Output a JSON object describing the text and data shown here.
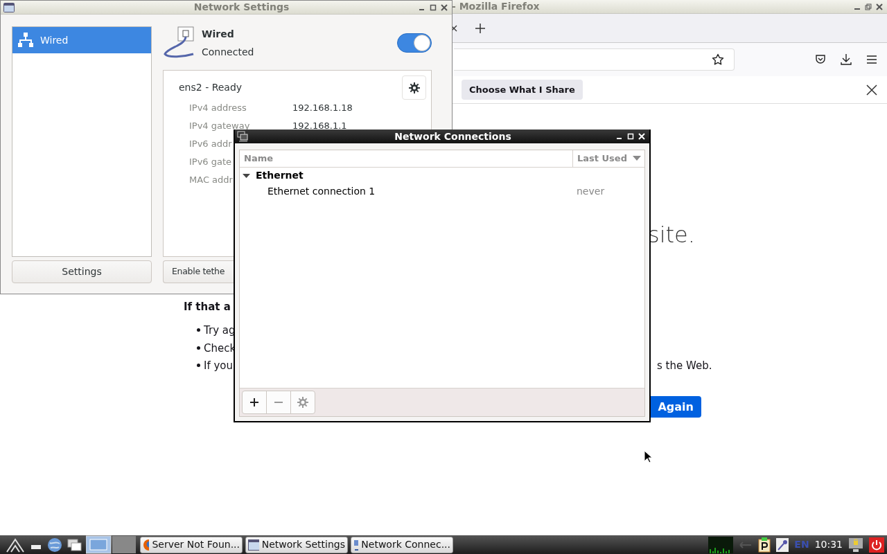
{
  "firefox": {
    "title": "- Mozilla Firefox",
    "notification": {
      "button": "Choose What I Share"
    },
    "page": {
      "heading": "site.",
      "subheading": "If that a",
      "bullets": [
        {
          "start": "Try ag"
        },
        {
          "start": "Check"
        },
        {
          "start": "If you",
          "end": "s the Web."
        }
      ],
      "button": "Again"
    }
  },
  "network_settings": {
    "title": "Network Settings",
    "sidebar": [
      {
        "label": "Wired",
        "selected": true
      }
    ],
    "settings_button": "Settings",
    "device": {
      "name": "Wired",
      "status": "Connected",
      "on": true
    },
    "connection": {
      "title": "ens2 - Ready",
      "rows": [
        {
          "label": "IPv4 address",
          "value": "192.168.1.18"
        },
        {
          "label": "IPv4 gateway",
          "value": "192.168.1.1"
        },
        {
          "label": "IPv6 addr"
        },
        {
          "label": "IPv6 gate"
        },
        {
          "label": "MAC addr"
        }
      ]
    },
    "tether_button": "Enable tethe"
  },
  "network_connections": {
    "title": "Network Connections",
    "columns": [
      "Name",
      "Last Used"
    ],
    "groups": [
      {
        "name": "Ethernet",
        "expanded": true,
        "children": [
          {
            "name": "Ethernet connection 1",
            "last_used": "never"
          }
        ]
      }
    ]
  },
  "taskbar": {
    "tasks": [
      {
        "label": "Server Not Foun...",
        "kind": "browser"
      },
      {
        "label": "Network Settings",
        "kind": "window"
      },
      {
        "label": "Network Connec...",
        "kind": "network"
      }
    ],
    "keyboard": "EN",
    "clock": "10:31"
  }
}
